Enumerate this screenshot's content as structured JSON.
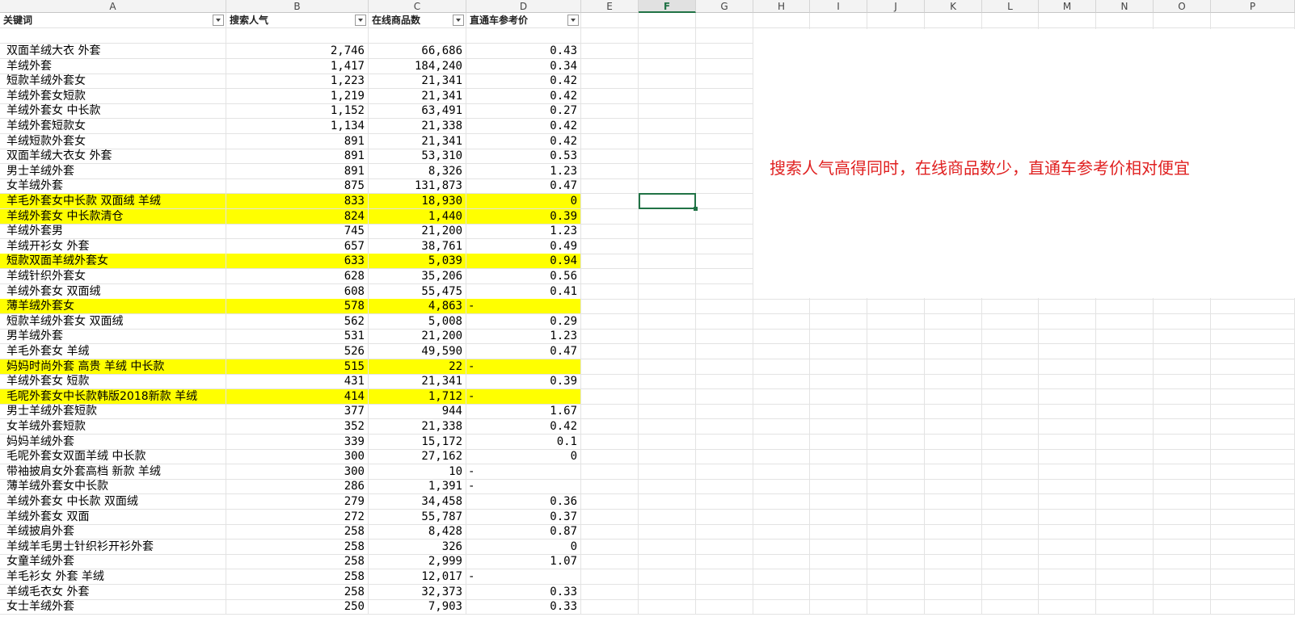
{
  "sheet": {
    "columns": [
      "A",
      "B",
      "C",
      "D",
      "E",
      "F",
      "G",
      "H",
      "I",
      "J",
      "K",
      "L",
      "M",
      "N",
      "O",
      "P"
    ],
    "selected_column": "F",
    "headers": [
      "关键词",
      "搜索人气",
      "在线商品数",
      "直通车参考价"
    ],
    "rows": [
      {
        "keyword": "双面羊绒大衣 外套",
        "popularity": "2,746",
        "online": "66,686",
        "price": "0.43",
        "highlight": false
      },
      {
        "keyword": "羊绒外套",
        "popularity": "1,417",
        "online": "184,240",
        "price": "0.34",
        "highlight": false
      },
      {
        "keyword": "短款羊绒外套女",
        "popularity": "1,223",
        "online": "21,341",
        "price": "0.42",
        "highlight": false
      },
      {
        "keyword": "羊绒外套女短款",
        "popularity": "1,219",
        "online": "21,341",
        "price": "0.42",
        "highlight": false
      },
      {
        "keyword": "羊绒外套女 中长款",
        "popularity": "1,152",
        "online": "63,491",
        "price": "0.27",
        "highlight": false
      },
      {
        "keyword": "羊绒外套短款女",
        "popularity": "1,134",
        "online": "21,338",
        "price": "0.42",
        "highlight": false
      },
      {
        "keyword": "羊绒短款外套女",
        "popularity": "891",
        "online": "21,341",
        "price": "0.42",
        "highlight": false
      },
      {
        "keyword": "双面羊绒大衣女 外套",
        "popularity": "891",
        "online": "53,310",
        "price": "0.53",
        "highlight": false
      },
      {
        "keyword": "男士羊绒外套",
        "popularity": "891",
        "online": "8,326",
        "price": "1.23",
        "highlight": false
      },
      {
        "keyword": "女羊绒外套",
        "popularity": "875",
        "online": "131,873",
        "price": "0.47",
        "highlight": false
      },
      {
        "keyword": "羊毛外套女中长款 双面绒 羊绒",
        "popularity": "833",
        "online": "18,930",
        "price": "0",
        "highlight": true
      },
      {
        "keyword": "羊绒外套女 中长款清仓",
        "popularity": "824",
        "online": "1,440",
        "price": "0.39",
        "highlight": true
      },
      {
        "keyword": "羊绒外套男",
        "popularity": "745",
        "online": "21,200",
        "price": "1.23",
        "highlight": false
      },
      {
        "keyword": "羊绒开衫女 外套",
        "popularity": "657",
        "online": "38,761",
        "price": "0.49",
        "highlight": false
      },
      {
        "keyword": "短款双面羊绒外套女",
        "popularity": "633",
        "online": "5,039",
        "price": "0.94",
        "highlight": true
      },
      {
        "keyword": "羊绒针织外套女",
        "popularity": "628",
        "online": "35,206",
        "price": "0.56",
        "highlight": false
      },
      {
        "keyword": "羊绒外套女 双面绒",
        "popularity": "608",
        "online": "55,475",
        "price": "0.41",
        "highlight": false
      },
      {
        "keyword": "薄羊绒外套女",
        "popularity": "578",
        "online": "4,863",
        "price": "-",
        "highlight": true
      },
      {
        "keyword": "短款羊绒外套女 双面绒",
        "popularity": "562",
        "online": "5,008",
        "price": "0.29",
        "highlight": false
      },
      {
        "keyword": "男羊绒外套",
        "popularity": "531",
        "online": "21,200",
        "price": "1.23",
        "highlight": false
      },
      {
        "keyword": "羊毛外套女 羊绒",
        "popularity": "526",
        "online": "49,590",
        "price": "0.47",
        "highlight": false
      },
      {
        "keyword": "妈妈时尚外套 高贵 羊绒 中长款",
        "popularity": "515",
        "online": "22",
        "price": "-",
        "highlight": true
      },
      {
        "keyword": "羊绒外套女 短款",
        "popularity": "431",
        "online": "21,341",
        "price": "0.39",
        "highlight": false
      },
      {
        "keyword": "毛呢外套女中长款韩版2018新款 羊绒",
        "popularity": "414",
        "online": "1,712",
        "price": "-",
        "highlight": true
      },
      {
        "keyword": "男士羊绒外套短款",
        "popularity": "377",
        "online": "944",
        "price": "1.67",
        "highlight": false
      },
      {
        "keyword": "女羊绒外套短款",
        "popularity": "352",
        "online": "21,338",
        "price": "0.42",
        "highlight": false
      },
      {
        "keyword": "妈妈羊绒外套",
        "popularity": "339",
        "online": "15,172",
        "price": "0.1",
        "highlight": false
      },
      {
        "keyword": "毛呢外套女双面羊绒 中长款",
        "popularity": "300",
        "online": "27,162",
        "price": "0",
        "highlight": false
      },
      {
        "keyword": "带袖披肩女外套高档 新款 羊绒",
        "popularity": "300",
        "online": "10",
        "price": "-",
        "highlight": false
      },
      {
        "keyword": "薄羊绒外套女中长款",
        "popularity": "286",
        "online": "1,391",
        "price": "-",
        "highlight": false
      },
      {
        "keyword": "羊绒外套女 中长款 双面绒",
        "popularity": "279",
        "online": "34,458",
        "price": "0.36",
        "highlight": false
      },
      {
        "keyword": "羊绒外套女 双面",
        "popularity": "272",
        "online": "55,787",
        "price": "0.37",
        "highlight": false
      },
      {
        "keyword": "羊绒披肩外套",
        "popularity": "258",
        "online": "8,428",
        "price": "0.87",
        "highlight": false
      },
      {
        "keyword": "羊绒羊毛男士针织衫开衫外套",
        "popularity": "258",
        "online": "326",
        "price": "0",
        "highlight": false
      },
      {
        "keyword": "女童羊绒外套",
        "popularity": "258",
        "online": "2,999",
        "price": "1.07",
        "highlight": false
      },
      {
        "keyword": "羊毛衫女 外套 羊绒",
        "popularity": "258",
        "online": "12,017",
        "price": "-",
        "highlight": false
      },
      {
        "keyword": "羊绒毛衣女 外套",
        "popularity": "258",
        "online": "32,373",
        "price": "0.33",
        "highlight": false
      },
      {
        "keyword": "女士羊绒外套",
        "popularity": "250",
        "online": "7,903",
        "price": "0.33",
        "highlight": false
      }
    ]
  },
  "note": {
    "text": "搜索人气高得同时，在线商品数少，直通车参考价相对便宜"
  }
}
